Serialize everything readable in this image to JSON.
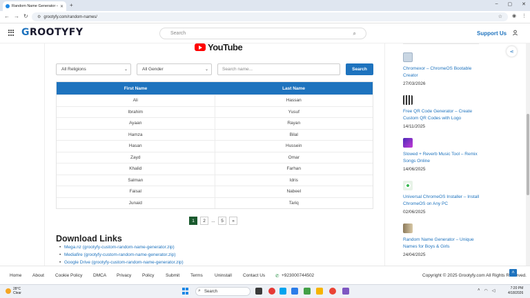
{
  "browser": {
    "tab_title": "Random Name Generator – Uni",
    "url": "grootyfy.com/random-names/",
    "new_tab": "+",
    "win_min": "–",
    "win_max": "▢",
    "win_close": "✕"
  },
  "header": {
    "logo_initial": "G",
    "logo_rest": "ROOTYFY",
    "search_placeholder": "Search",
    "support": "Support Us"
  },
  "youtube": {
    "word": "YouTube"
  },
  "filters": {
    "religion": "All Religions",
    "gender": "All Gender",
    "name_placeholder": "Search name...",
    "search_button": "Search"
  },
  "table": {
    "col1": "First Name",
    "col2": "Last Name",
    "rows": [
      [
        "Ali",
        "Hassan"
      ],
      [
        "Ibrahim",
        "Yusuf"
      ],
      [
        "Ayaan",
        "Rayan"
      ],
      [
        "Hamza",
        "Bilal"
      ],
      [
        "Hasan",
        "Hussein"
      ],
      [
        "Zayd",
        "Omar"
      ],
      [
        "Khalid",
        "Farhan"
      ],
      [
        "Salman",
        "Idris"
      ],
      [
        "Faisal",
        "Nabeel"
      ],
      [
        "Junaid",
        "Tariq"
      ]
    ]
  },
  "pager": {
    "p1": "1",
    "p2": "2",
    "dots": "...",
    "p5": "5",
    "next": "»"
  },
  "downloads": {
    "heading": "Download Links",
    "links": [
      "Mega.nz (grootyfy-custom-random-name-generator.zip)",
      "Mediafire (grootyfy-custom-random-name-generator.zip)",
      "Google Drive (grootyfy-custom-random-name-generator.zip)"
    ]
  },
  "sidebar": {
    "items": [
      {
        "title": "Chromexor – ChromeOS Bootable Creator",
        "date": "27/03/2026",
        "color": "#c9d6e3"
      },
      {
        "title": "Free QR Code Generator – Create Custom QR Codes with Logo",
        "date": "14/11/2025",
        "color": "#3b3b3b"
      },
      {
        "title": "Slowed + Reverb Music Tool – Remix Songs Online",
        "date": "14/06/2025",
        "color": "#7a4bd1"
      },
      {
        "title": "Universal ChromeOS Installer – Install ChromeOS on Any PC",
        "date": "02/06/2025",
        "color": "#e8f3e8"
      },
      {
        "title": "Random Name Generator – Unique Names for Boys & Girls",
        "date": "24/04/2025",
        "color": "#b9a27c"
      }
    ]
  },
  "footer": {
    "links": [
      "Home",
      "About",
      "Cookie Policy",
      "DMCA",
      "Privacy",
      "Policy",
      "Submit",
      "Terms",
      "Uninstall",
      "Contact Us"
    ],
    "phone": "+923000744502",
    "copyright": "Copyright © 2025 Grootyfy.com All Rights Reserved."
  },
  "taskbar": {
    "temp": "28°C",
    "weather": "Clear",
    "search": "Search",
    "time": "7:20 PM",
    "date": "4/18/2026"
  }
}
